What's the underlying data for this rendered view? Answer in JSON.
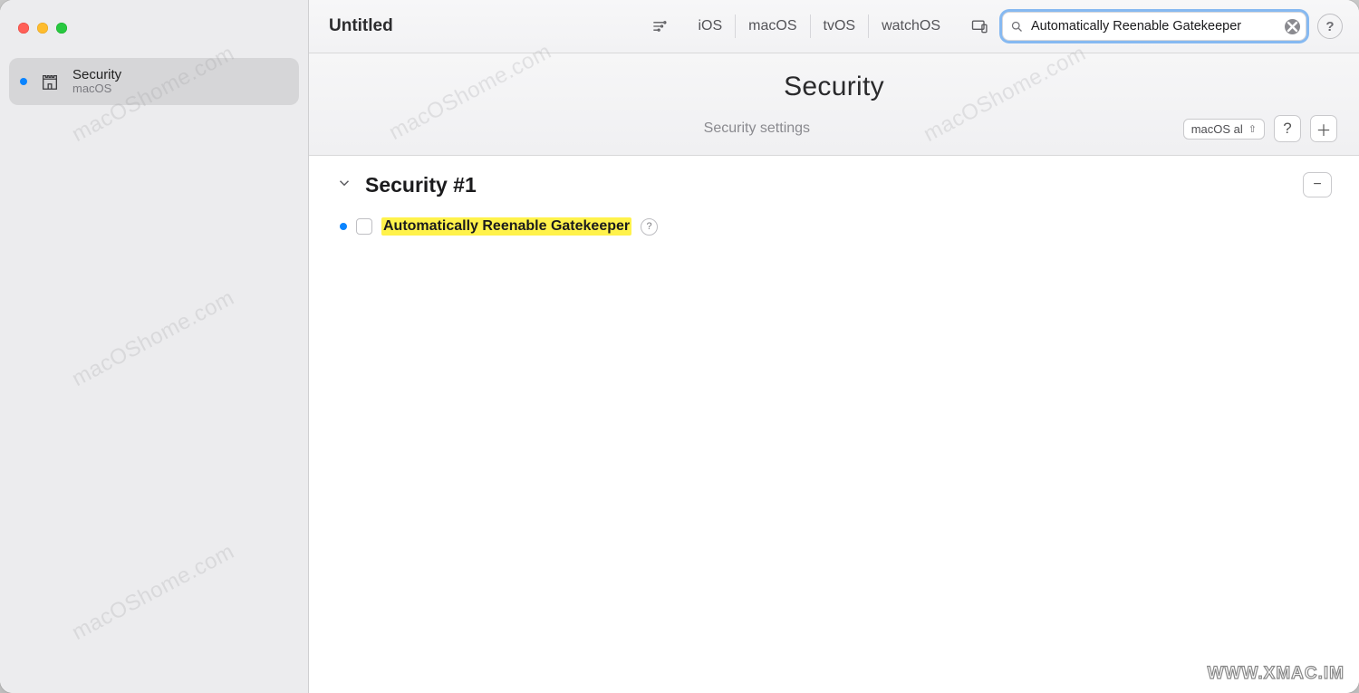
{
  "window": {
    "title": "Untitled"
  },
  "sidebar": {
    "items": [
      {
        "title": "Security",
        "subtitle": "macOS"
      }
    ]
  },
  "toolbar": {
    "platforms": [
      "iOS",
      "macOS",
      "tvOS",
      "watchOS"
    ],
    "search_value": "Automatically Reenable Gatekeeper",
    "help_glyph": "?"
  },
  "subheader": {
    "title": "Security",
    "description": "Security settings",
    "chip_label": "macOS  al",
    "chip_glyph": "⇧",
    "help_glyph": "?",
    "plus_glyph": "＋"
  },
  "content": {
    "group_title": "Security #1",
    "minus_glyph": "−",
    "setting_label": "Automatically Reenable Gatekeeper",
    "setting_help_glyph": "?"
  },
  "watermarks": {
    "a": "macOShome.com",
    "b": "WWW.XMAC.IM"
  }
}
